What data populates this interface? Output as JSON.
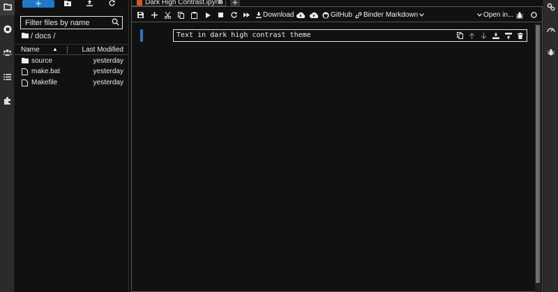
{
  "left_bar": {
    "icons": [
      "folder-icon",
      "running-icon",
      "users-icon",
      "table-of-contents-icon",
      "extension-icon"
    ]
  },
  "file_browser": {
    "new_launcher_label": "+",
    "filter": {
      "placeholder": "Filter files by name",
      "value": ""
    },
    "breadcrumb": {
      "path": "/ docs /"
    },
    "columns": {
      "name": "Name",
      "modified": "Last Modified"
    },
    "files": [
      {
        "type": "folder",
        "name": "source",
        "modified": "yesterday"
      },
      {
        "type": "file",
        "name": "make.bat",
        "modified": "yesterday"
      },
      {
        "type": "file",
        "name": "Makefile",
        "modified": "yesterday"
      }
    ]
  },
  "tabs": [
    {
      "label": "Dark High Contrast.ipynb",
      "close": "✕"
    }
  ],
  "tab_add_label": "+",
  "notebook_toolbar": {
    "download_label": "Download",
    "github_label": "GitHub",
    "binder_label": "Binder",
    "cell_type_label": "Markdown",
    "open_in_label": "Open in..."
  },
  "cell": {
    "source": "Text in dark high contrast theme"
  },
  "colors": {
    "accent": "#1f78c8",
    "background": "#111111",
    "sidebar": "#2b2b2b",
    "text": "#f0f0f0",
    "notebook_icon": "#d35a1c"
  }
}
